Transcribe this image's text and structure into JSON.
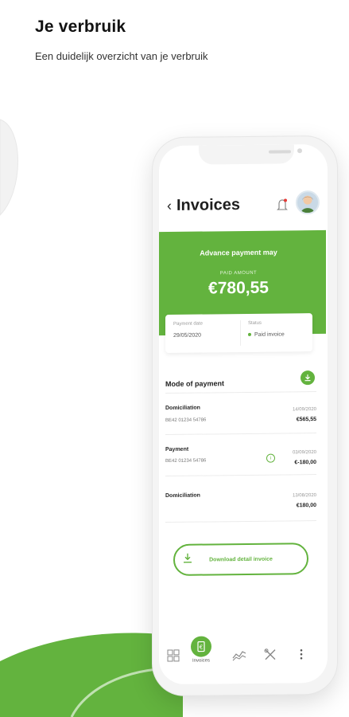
{
  "page": {
    "title": "Je verbruik",
    "subtitle": "Een duidelijk overzicht van je verbruik"
  },
  "app": {
    "screen_title": "Invoices",
    "card": {
      "title": "Advance payment may",
      "paid_label": "PAID AMOUNT",
      "amount": "€780,55"
    },
    "info": {
      "payment_date_label": "Payment date",
      "payment_date": "29/05/2020",
      "status_label": "Status",
      "status": "Paid invoice"
    },
    "mode_of_payment": {
      "title": "Mode of payment",
      "rows": [
        {
          "title": "Domiciliation",
          "sub": "BE42 01234 54786",
          "date": "14/09/2020",
          "amount": "€565,55"
        },
        {
          "title": "Payment",
          "sub": "BE42 01234 54786",
          "date": "03/09/2020",
          "amount": "€-180,00"
        },
        {
          "title": "Domiciliation",
          "sub": "",
          "date": "13/08/2020",
          "amount": "€180,00"
        }
      ]
    },
    "download_button": "Download detail invoice",
    "nav": {
      "center_label": "Invoices",
      "items": [
        "dashboard-icon",
        "invoice-icon",
        "consumption-icon",
        "tools-icon",
        "more-icon"
      ]
    },
    "colors": {
      "accent": "#63b33e",
      "text": "#1a1a1a"
    }
  }
}
